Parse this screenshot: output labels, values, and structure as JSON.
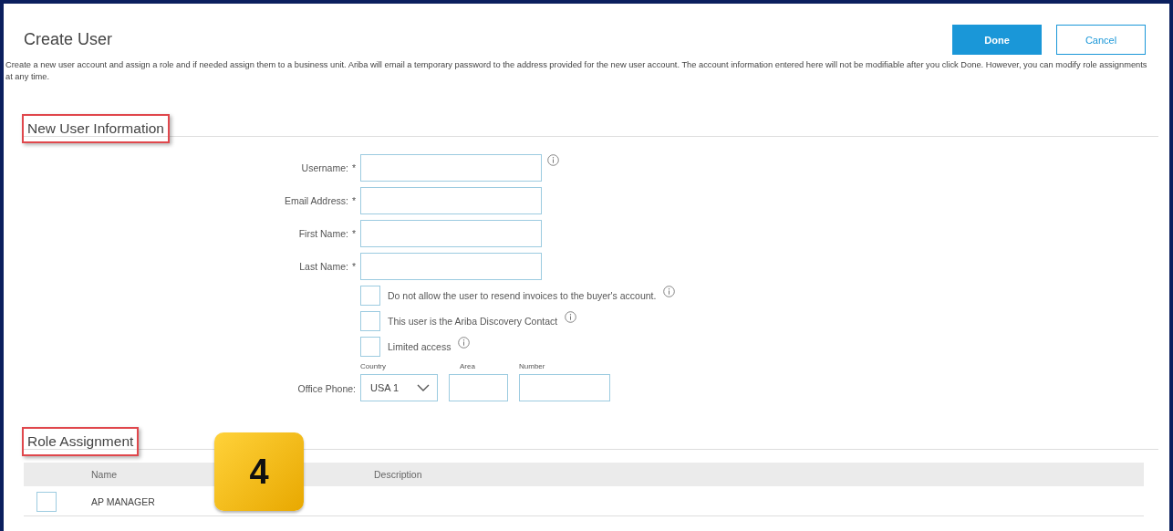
{
  "header": {
    "title": "Create User",
    "buttons": [
      {
        "label": "Done",
        "kind": "primary"
      },
      {
        "label": "Cancel",
        "kind": "secondary"
      }
    ]
  },
  "description": "Create a new user account and assign a role and if needed assign them to a business unit. Ariba will email a temporary password to the address provided for the new user account. The account information entered here will not be modifiable after you click Done. However, you can modify role assignments at any time.",
  "user_section": {
    "title": "New User Information",
    "highlighted": true,
    "fields": [
      {
        "label": "Username:",
        "required_mark": "*",
        "info": true
      },
      {
        "label": "Email Address:",
        "required_mark": "*",
        "info": false
      },
      {
        "label": "First Name:",
        "required_mark": "*",
        "info": false
      },
      {
        "label": "Last Name:",
        "required_mark": "*",
        "info": false
      }
    ],
    "checkboxes": [
      {
        "label": "Do not allow the user to resend invoices to the buyer's account.",
        "checked": false,
        "info": true
      },
      {
        "label": "This user is the Ariba Discovery Contact",
        "checked": false,
        "info": true
      },
      {
        "label": "Limited access",
        "checked": false,
        "info": true
      }
    ],
    "phone": {
      "label": "Office Phone:",
      "country_label": "Country",
      "country_value": "USA 1",
      "area_label": "Area",
      "number_label": "Number"
    }
  },
  "role_section": {
    "title": "Role Assignment",
    "highlighted": true,
    "columns": [
      "Name",
      "Description"
    ],
    "rows": [
      {
        "name": "AP MANAGER",
        "checked": false
      }
    ]
  },
  "step_badge": "4"
}
